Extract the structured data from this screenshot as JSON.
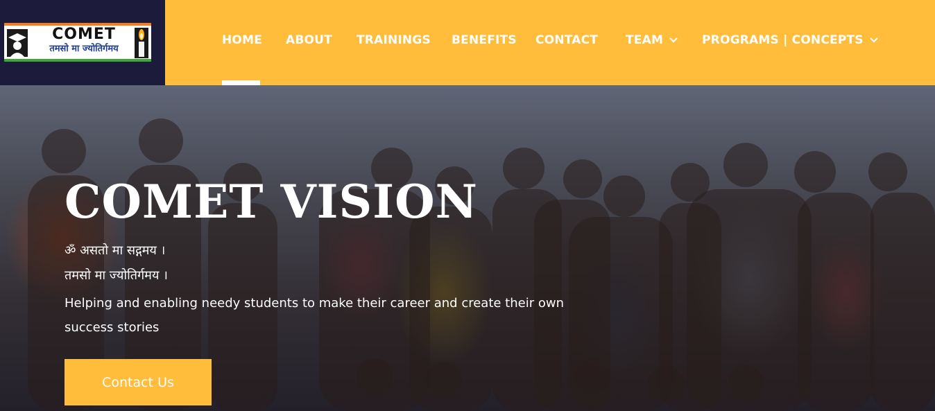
{
  "logo": {
    "title": "COMET",
    "subtitle": "तमसो मा ज्योतिर्गमय"
  },
  "nav": {
    "items": [
      {
        "label": "HOME",
        "active": true
      },
      {
        "label": "ABOUT"
      },
      {
        "label": "TRAININGS"
      },
      {
        "label": "BENEFITS"
      },
      {
        "label": "CONTACT"
      },
      {
        "label": "TEAM",
        "dropdown": true
      },
      {
        "label": "PROGRAMS | CONCEPTS",
        "dropdown": true
      }
    ]
  },
  "hero": {
    "title": "COMET VISION",
    "line1": "ॐ असतो मा सद्गमय ।",
    "line2": "तमसो मा ज्योतिर्गमय ।",
    "description": "Helping and enabling needy students to make their career and create their own success stories",
    "cta_label": "Contact Us"
  },
  "colors": {
    "nav_bg": "#ffbd3b",
    "logo_bg": "#1c1b3b",
    "cta_bg": "#ffbd3b",
    "text": "#ffffff"
  }
}
